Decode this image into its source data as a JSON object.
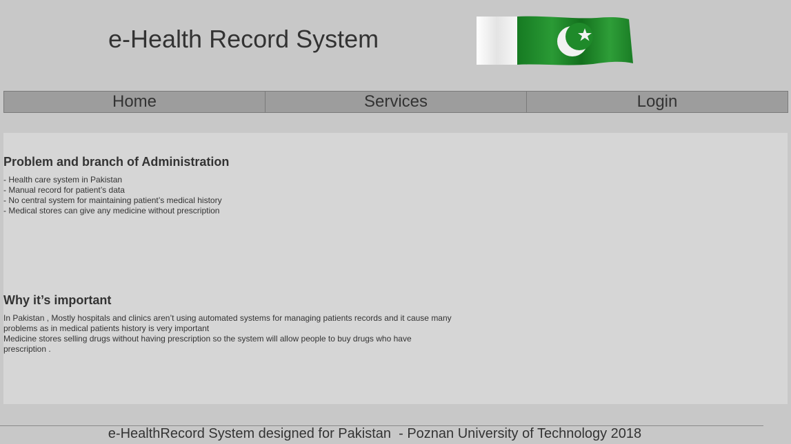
{
  "header": {
    "title": "e-Health Record System",
    "flag_icon": "pakistan-flag-icon",
    "flag_colors": {
      "green": "#1f8a2a",
      "white": "#f3f3f3"
    }
  },
  "nav": {
    "items": [
      {
        "label": "Home"
      },
      {
        "label": "Services"
      },
      {
        "label": "Login"
      }
    ]
  },
  "main": {
    "sections": [
      {
        "heading": "Problem and branch of Administration",
        "lines": [
          "- Health care system in Pakistan",
          "- Manual record for patient’s data",
          "- No central system for maintaining patient’s medical history",
          "- Medical stores can give any medicine without prescription"
        ]
      },
      {
        "heading": "Why it’s important",
        "lines": [
          "In Pakistan , Mostly hospitals and clinics aren’t using automated systems for managing patients records and it cause many problems as in medical patients history is very important",
          "Medicine stores selling drugs without having prescription so the system will allow people to buy drugs who have prescription ."
        ]
      }
    ]
  },
  "footer": {
    "text": "e-HealthRecord System designed for Pakistan  - Poznan University of Technology 2018"
  }
}
